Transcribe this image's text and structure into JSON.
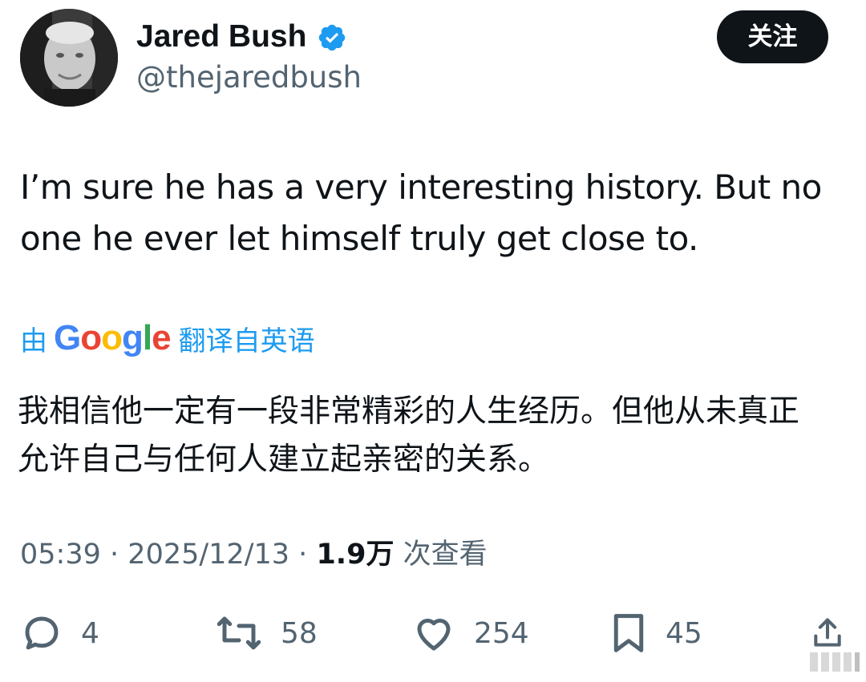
{
  "author": {
    "display_name": "Jared Bush",
    "handle": "@thejaredbush",
    "verified": true
  },
  "follow_button": {
    "label": "关注"
  },
  "tweet": {
    "text": "I’m sure he has a very interesting history. But no one he ever let himself truly get close to."
  },
  "translation": {
    "prefix": "由",
    "provider": "Google",
    "suffix": "翻译自英语",
    "text": "我相信他一定有一段非常精彩的人生经历。但他从未真正允许自己与任何人建立起亲密的关系。"
  },
  "meta": {
    "time": "05:39",
    "separator": "·",
    "date": "2025/12/13",
    "views_count": "1.9万",
    "views_label": "次查看"
  },
  "actions": {
    "replies": "4",
    "reposts": "58",
    "likes": "254",
    "bookmarks": "45"
  },
  "colors": {
    "text": "#0f1419",
    "muted": "#536471",
    "link": "#1d9bf0",
    "verified": "#1d9bf0",
    "button_bg": "#0f1419"
  },
  "icons": {
    "verified": "verified-badge-icon",
    "reply": "reply-bubble-icon",
    "repost": "repost-arrows-icon",
    "like": "heart-icon",
    "bookmark": "bookmark-icon",
    "share": "share-upload-icon"
  }
}
